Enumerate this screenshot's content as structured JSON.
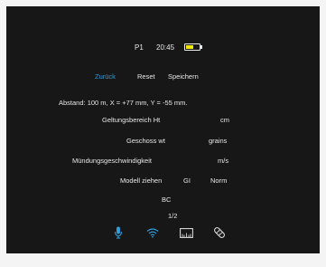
{
  "status": {
    "profile": "P1",
    "time": "20:45",
    "battery_level": 0.6,
    "battery_color": "#f2e60a"
  },
  "actions": {
    "back": "Zurück",
    "reset": "Reset",
    "save": "Speichern"
  },
  "distance_line": "Abstand: 100 m, X = +77 mm, Y = -55 mm.",
  "fields": {
    "range_label": "Geltungsbereich Ht",
    "range_unit": "cm",
    "weight_label": "Geschoss wt",
    "weight_unit": "grains",
    "velocity_label": "Mündungsgeschwindigkeit",
    "velocity_unit": "m/s",
    "model_label": "Modell ziehen",
    "model_value": "GI",
    "model_option": "Norm",
    "bc_label": "BC"
  },
  "pagination": "1/2",
  "bottom_icons": [
    "microphone-icon",
    "wifi-icon",
    "ruler-icon",
    "bandage-icon"
  ],
  "colors": {
    "accent": "#2f9bd8",
    "background": "#171717",
    "text": "#e8e8e8"
  }
}
